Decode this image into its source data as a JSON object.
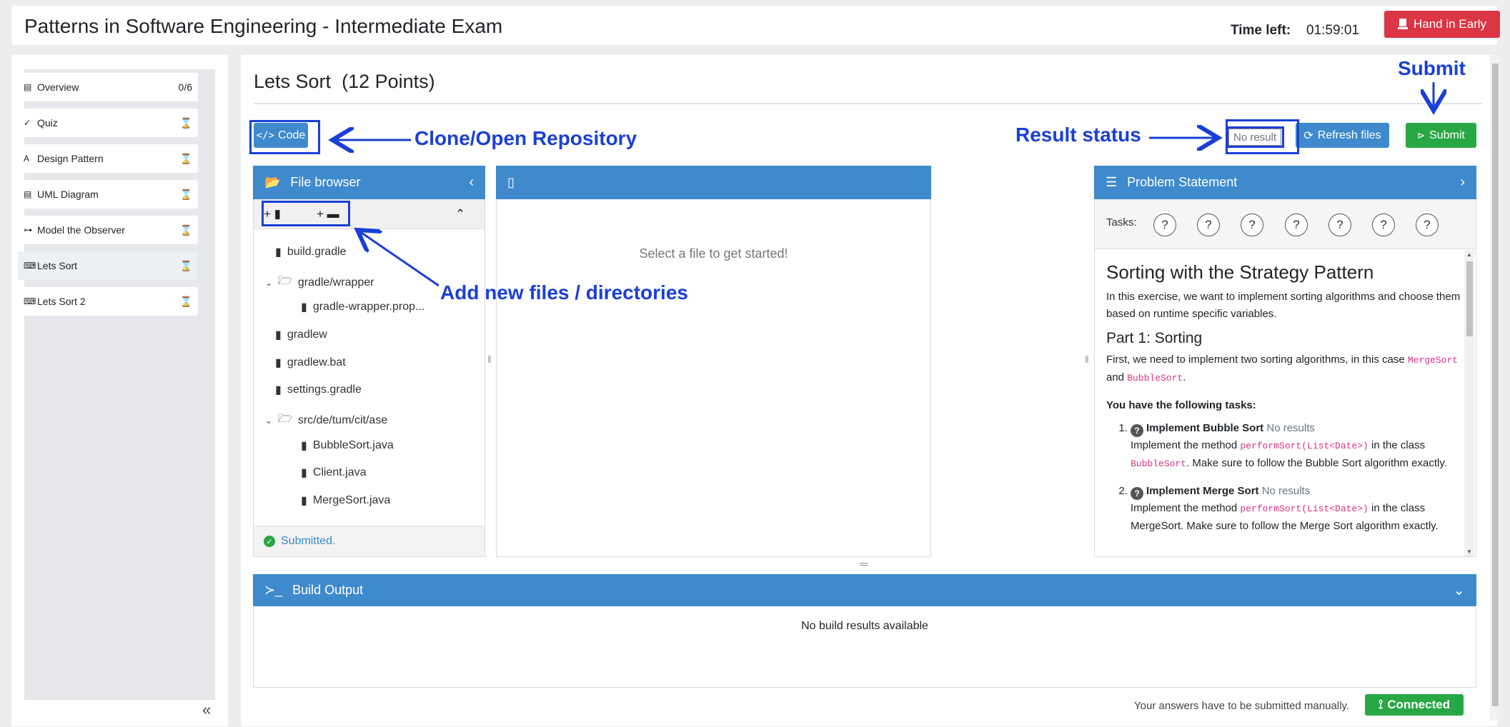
{
  "header": {
    "title": "Patterns in Software Engineering - Intermediate Exam",
    "time_left_label": "Time left:",
    "time_left_value": "01:59:01",
    "hand_in_label": "Hand in Early"
  },
  "sidebar": {
    "items": [
      {
        "label": "Overview",
        "icon": "document-icon",
        "status": "0/6"
      },
      {
        "label": "Quiz",
        "icon": "check-double-icon",
        "status": "hourglass"
      },
      {
        "label": "Design Pattern",
        "icon": "letter-a-icon",
        "status": "hourglass"
      },
      {
        "label": "UML Diagram",
        "icon": "document-icon",
        "status": "hourglass"
      },
      {
        "label": "Model the Observer",
        "icon": "diagram-icon",
        "status": "hourglass"
      },
      {
        "label": "Lets Sort",
        "icon": "keyboard-icon",
        "status": "hourglass"
      },
      {
        "label": "Lets Sort 2",
        "icon": "keyboard-icon",
        "status": "hourglass"
      }
    ],
    "collapse_glyph": "«"
  },
  "exercise": {
    "title": "Lets Sort",
    "points": "(12 Points)",
    "code_button": "Code",
    "result_badge": "No result",
    "refresh_button": "Refresh files",
    "submit_button": "Submit"
  },
  "annotations": {
    "clone": "Clone/Open Repository",
    "result_status": "Result status",
    "submit": "Submit",
    "add_files": "Add new files / directories"
  },
  "file_browser": {
    "title": "File browser",
    "items": [
      {
        "name": "build.gradle",
        "type": "file",
        "depth": 0
      },
      {
        "name": "gradle/wrapper",
        "type": "folder",
        "depth": 0
      },
      {
        "name": "gradle-wrapper.prop...",
        "type": "file",
        "depth": 1
      },
      {
        "name": "gradlew",
        "type": "file",
        "depth": 0
      },
      {
        "name": "gradlew.bat",
        "type": "file",
        "depth": 0
      },
      {
        "name": "settings.gradle",
        "type": "file",
        "depth": 0
      },
      {
        "name": "src/de/tum/cit/ase",
        "type": "folder",
        "depth": 0
      },
      {
        "name": "BubbleSort.java",
        "type": "file",
        "depth": 1
      },
      {
        "name": "Client.java",
        "type": "file",
        "depth": 1
      },
      {
        "name": "MergeSort.java",
        "type": "file",
        "depth": 1
      }
    ],
    "status": "Submitted."
  },
  "editor": {
    "placeholder": "Select a file to get started!"
  },
  "problem": {
    "title": "Problem Statement",
    "tasks_label": "Tasks:",
    "task_markers": [
      "?",
      "?",
      "?",
      "?",
      "?",
      "?",
      "?"
    ],
    "heading": "Sorting with the Strategy Pattern",
    "intro": "In this exercise, we want to implement sorting algorithms and choose them based on runtime specific variables.",
    "part1": "Part 1: Sorting",
    "part1_text_a": "First, we need to implement two sorting algorithms, in this case",
    "code_merge": "MergeSort",
    "and": "and",
    "code_bubble": "BubbleSort",
    "period": ".",
    "tasks_intro": "You have the following tasks:",
    "task1_title": "Implement Bubble Sort",
    "task1_result": "No results",
    "task1_text_a": "Implement the method",
    "task1_code": "performSort(List<Date>)",
    "task1_text_b": "in the class",
    "task1_class": "BubbleSort",
    "task1_text_c": ". Make sure to follow the Bubble Sort algorithm exactly.",
    "task2_title": "Implement Merge Sort",
    "task2_result": "No results",
    "task2_text_a": "Implement the method",
    "task2_code": "performSort(List<Date>)",
    "task2_text_b": "in the class",
    "task2_text_c": "MergeSort. Make sure to follow the Merge Sort algorithm exactly."
  },
  "build": {
    "title": "Build Output",
    "empty": "No build results available"
  },
  "footer": {
    "manual_note": "Your answers have to be submitted manually.",
    "connected": "Connected"
  },
  "colors": {
    "primary": "#3e8acc",
    "danger": "#dc3545",
    "success": "#28a745",
    "annotation": "#1a3fd6"
  }
}
